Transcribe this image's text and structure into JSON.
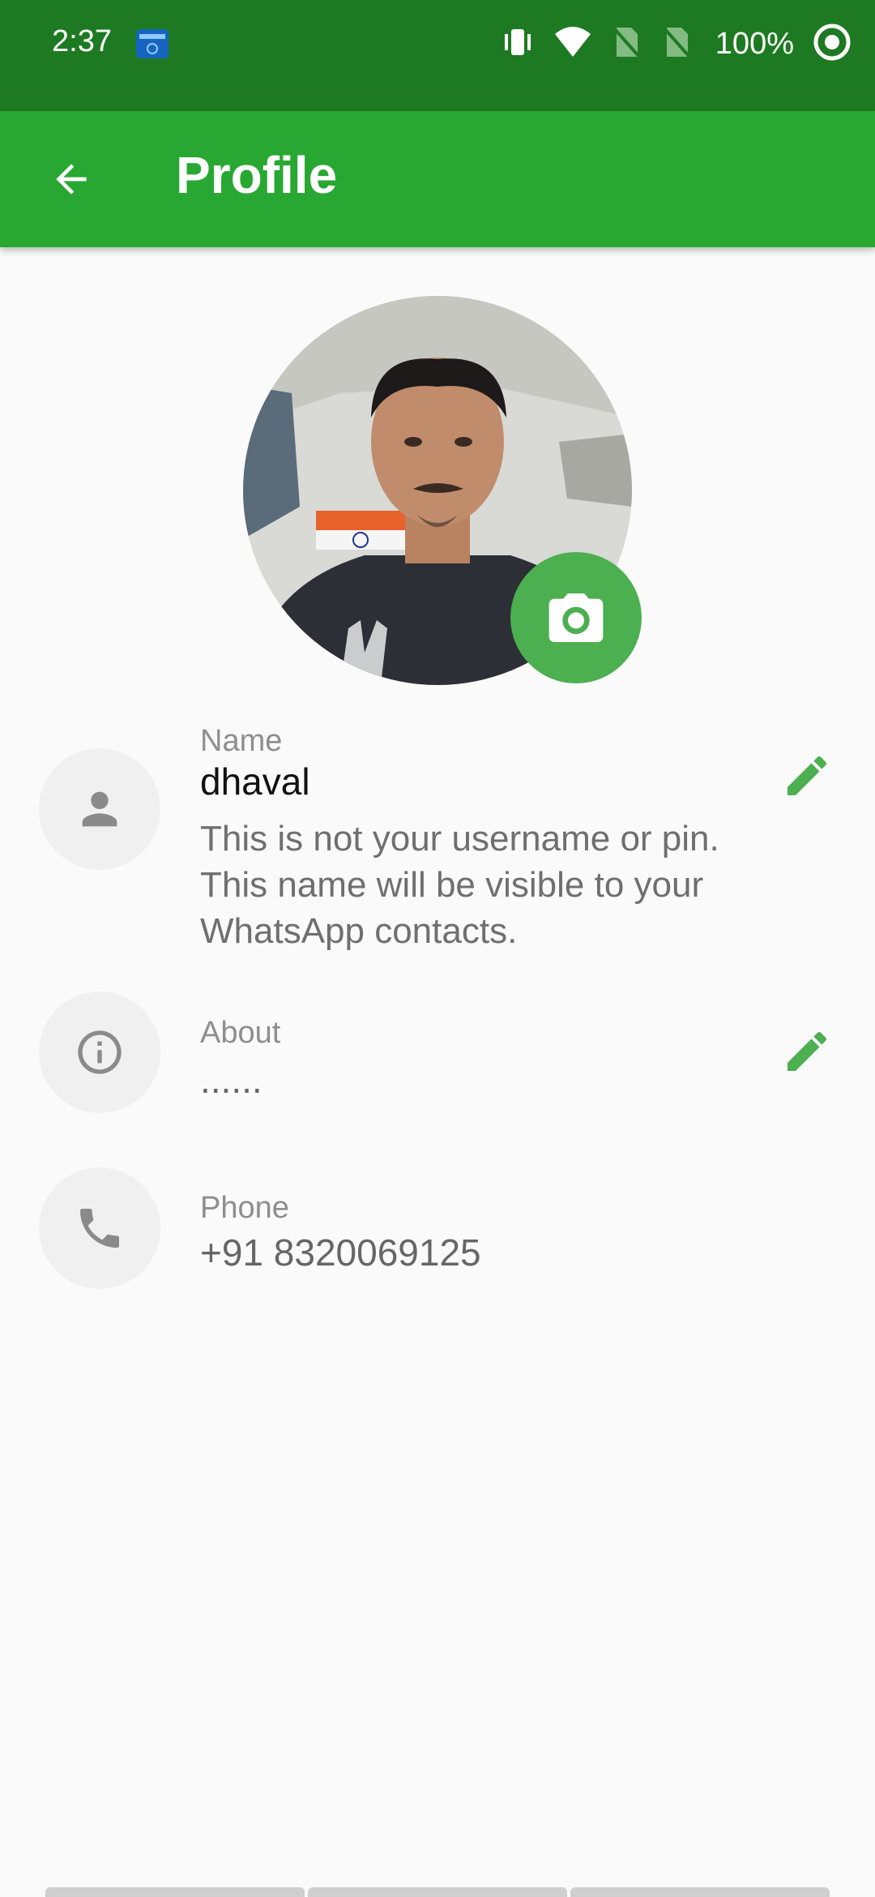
{
  "status_bar": {
    "time": "2:37",
    "battery": "100%",
    "icons": [
      "app-notification-icon",
      "vibrate-icon",
      "wifi-icon",
      "no-sim-icon",
      "no-sim-icon",
      "data-saver-icon"
    ]
  },
  "app_bar": {
    "title": "Profile",
    "back_icon": "arrow-back-icon",
    "color": "#28a832"
  },
  "profile": {
    "photo_icon": "avatar-photo",
    "camera_icon": "camera-icon",
    "accent": "#4caf50"
  },
  "fields": {
    "name": {
      "label": "Name",
      "value": "dhaval",
      "hint": "This is not your username or pin. This name will be visible to your WhatsApp contacts.",
      "icon": "person-icon",
      "edit_icon": "edit-pencil-icon"
    },
    "about": {
      "label": "About",
      "value": "......",
      "icon": "info-icon",
      "edit_icon": "edit-pencil-icon"
    },
    "phone": {
      "label": "Phone",
      "value": "+91 8320069125",
      "icon": "phone-icon"
    }
  }
}
